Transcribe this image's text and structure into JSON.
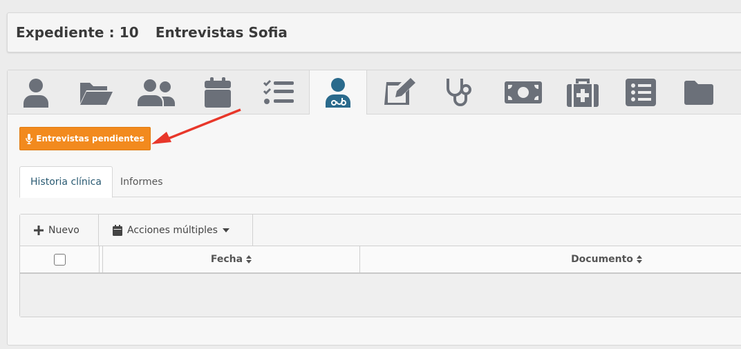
{
  "header": {
    "title": "Expediente : 10",
    "subtitle": "Entrevistas Sofia"
  },
  "iconbar": {
    "icons": [
      {
        "name": "user-icon"
      },
      {
        "name": "folder-open-icon"
      },
      {
        "name": "users-icon"
      },
      {
        "name": "calendar-icon"
      },
      {
        "name": "tasks-icon"
      },
      {
        "name": "user-doctor-icon",
        "active": true
      },
      {
        "name": "edit-icon"
      },
      {
        "name": "stethoscope-icon"
      },
      {
        "name": "money-icon"
      },
      {
        "name": "medkit-icon"
      },
      {
        "name": "list-icon"
      },
      {
        "name": "folder-icon"
      }
    ],
    "icon_color": "#6b7079",
    "active_color": "#2a6a8c"
  },
  "actions": {
    "pending_interviews": "Entrevistas pendientes"
  },
  "tabs": [
    {
      "label": "Historia clínica",
      "active": true
    },
    {
      "label": "Informes",
      "active": false
    }
  ],
  "toolbar": {
    "new_label": "Nuevo",
    "bulk_label": "Acciones múltiples"
  },
  "table": {
    "columns": [
      "Fecha",
      "Documento"
    ]
  },
  "colors": {
    "accent_orange": "#f28a1e",
    "arrow_red": "#e8372a"
  }
}
